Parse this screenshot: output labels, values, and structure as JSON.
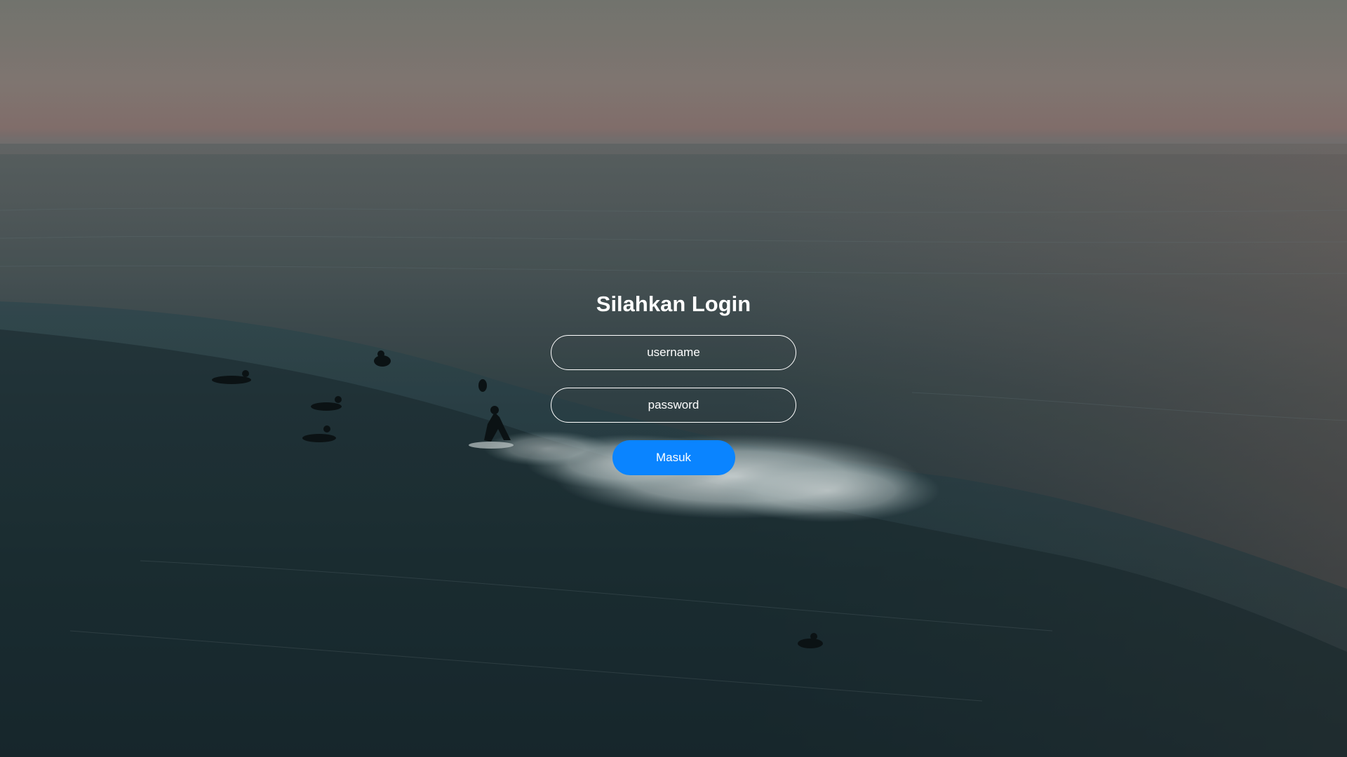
{
  "login": {
    "title": "Silahkan Login",
    "username_placeholder": "username",
    "password_placeholder": "password",
    "submit_label": "Masuk"
  },
  "colors": {
    "button": "#0a84ff",
    "text": "#ffffff",
    "field_border": "#ffffff"
  },
  "background": {
    "description_icon": "ocean-surf-photo"
  }
}
